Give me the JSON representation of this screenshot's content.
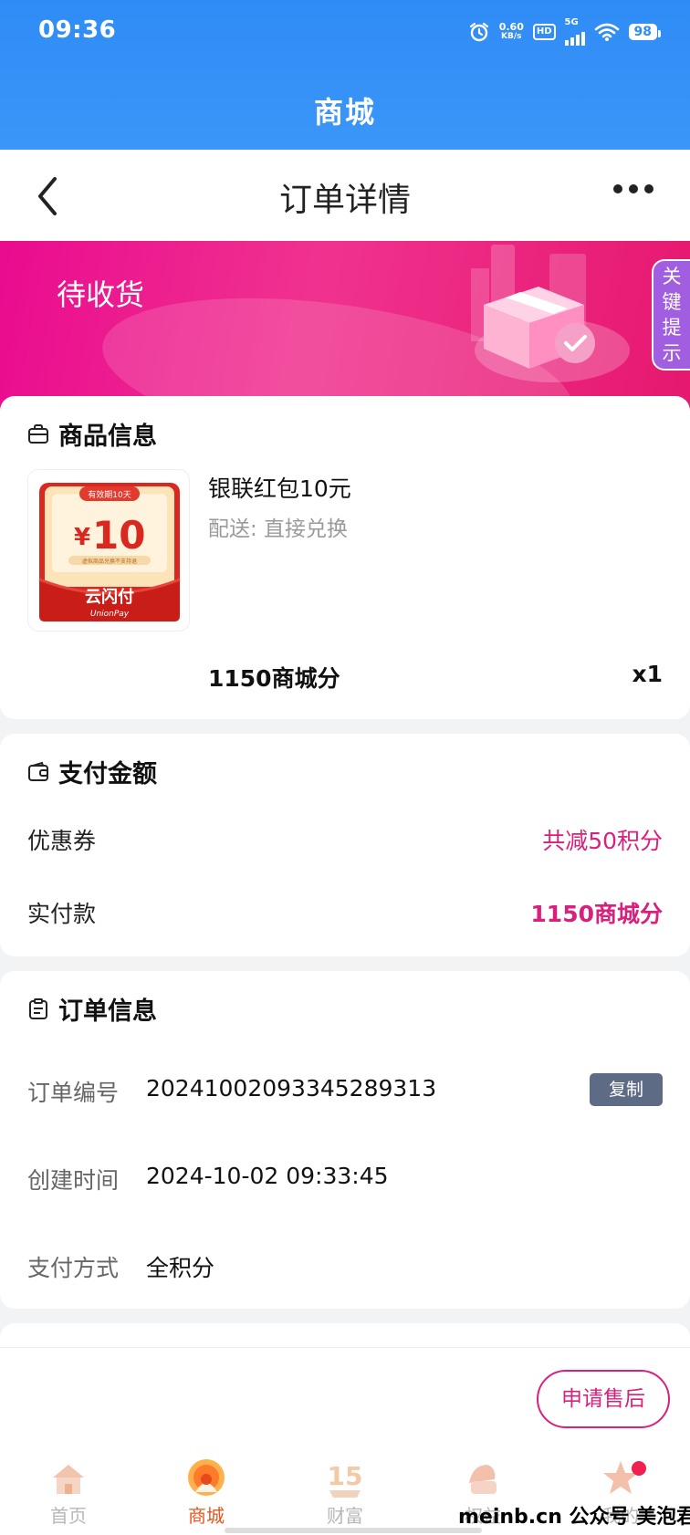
{
  "status_bar": {
    "time": "09:36",
    "net_speed_value": "0.60",
    "net_speed_unit": "KB/s",
    "hd": "HD",
    "network": "5G",
    "battery": "98",
    "icons": [
      "alarm-icon",
      "wifi-icon",
      "signal-icon",
      "battery-icon"
    ]
  },
  "app": {
    "title": "商城"
  },
  "navbar": {
    "title": "订单详情",
    "back_icon": "chevron-left-icon",
    "more_icon": "more-dots-icon"
  },
  "banner": {
    "status": "待收货",
    "key_tip": "关键提示"
  },
  "product_card": {
    "title": "商品信息",
    "name": "银联红包10元",
    "delivery": "配送: 直接兑换",
    "price": "1150商城分",
    "qty": "x1",
    "image": {
      "badge": "有效期10天",
      "amount_symbol": "¥",
      "amount": "10",
      "fine_print": "虚拟商品兑换不支持退",
      "brand": "云闪付",
      "brand_en": "UnionPay"
    }
  },
  "payment_card": {
    "title": "支付金额",
    "coupon_label": "优惠券",
    "coupon_value": "共减50积分",
    "paid_label": "实付款",
    "paid_value": "1150商城分"
  },
  "order_card": {
    "title": "订单信息",
    "order_no_label": "订单编号",
    "order_no": "20241002093345289313",
    "copy_label": "复制",
    "created_label": "创建时间",
    "created": "2024-10-02 09:33:45",
    "pay_method_label": "支付方式",
    "pay_method": "全积分"
  },
  "bottom": {
    "after_sale_label": "申请售后"
  },
  "tabbar": {
    "items": [
      {
        "label": "首页",
        "icon": "home-icon"
      },
      {
        "label": "商城",
        "icon": "mall-icon"
      },
      {
        "label": "财富",
        "icon": "wealth-15-icon"
      },
      {
        "label": "权益",
        "icon": "benefits-icon"
      },
      {
        "label": "我的",
        "icon": "profile-icon"
      }
    ],
    "active_index": 1
  },
  "watermark": "meinb.cn 公众号 美泡君",
  "colors": {
    "header_blue": "#2f8cf6",
    "accent_pink": "#d8207d",
    "banner_pink": "#ea0b8f",
    "active_tab": "#e2561d"
  }
}
